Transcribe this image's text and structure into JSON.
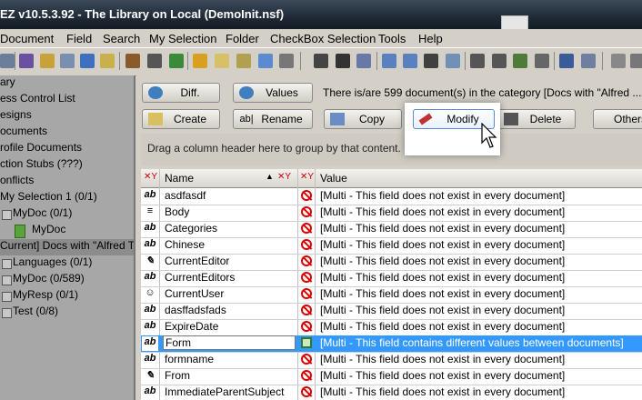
{
  "window": {
    "title": "EZ v10.5.3.92 - The Library on Local (DemoInit.nsf)"
  },
  "menu": [
    "Document",
    "Field",
    "Search",
    "My Selection",
    "Folder",
    "CheckBox Selection",
    "Tools",
    "Help"
  ],
  "left": {
    "items": [
      {
        "label": "ary"
      },
      {
        "label": "ess Control List"
      },
      {
        "label": "esigns"
      },
      {
        "label": "ocuments"
      },
      {
        "label": "rofile Documents"
      },
      {
        "label": "ction Stubs (???)"
      },
      {
        "label": "onflicts"
      },
      {
        "label": "My Selection 1  (0/1)"
      },
      {
        "label": "MyDoc  (0/1)"
      },
      {
        "label": "MyDoc"
      },
      {
        "label": "Current] Docs with \"Alfred T"
      },
      {
        "label": "Languages  (0/1)"
      },
      {
        "label": "MyDoc  (0/589)"
      },
      {
        "label": "MyResp  (0/1)"
      },
      {
        "label": "Test  (0/8)"
      }
    ]
  },
  "buttons": {
    "diff": "Diff.",
    "values": "Values",
    "create": "Create",
    "rename": "Rename",
    "copy": "Copy",
    "modify": "Modify",
    "delete": "Delete",
    "others": "Others"
  },
  "info_text": "There is/are 599 document(s) in the category [Docs with \"Alfred ...",
  "group_hint": "Drag a column header here to group by that content.",
  "grid": {
    "headers": {
      "name": "Name",
      "value": "Value"
    },
    "rows": [
      {
        "type": "ab",
        "name": "asdfasdf",
        "value": "[Multi - This field does not exist in every document]"
      },
      {
        "type": "≡",
        "name": "Body",
        "value": "[Multi - This field does not exist in every document]"
      },
      {
        "type": "ab",
        "name": "Categories",
        "value": "[Multi - This field does not exist in every document]"
      },
      {
        "type": "ab",
        "name": "Chinese",
        "value": "[Multi - This field does not exist in every document]"
      },
      {
        "type": "✎",
        "name": "CurrentEditor",
        "value": "[Multi - This field does not exist in every document]"
      },
      {
        "type": "ab",
        "name": "CurrentEditors",
        "value": "[Multi - This field does not exist in every document]"
      },
      {
        "type": "☺",
        "name": "CurrentUser",
        "value": "[Multi - This field does not exist in every document]"
      },
      {
        "type": "ab",
        "name": "dasffadsfads",
        "value": "[Multi - This field does not exist in every document]"
      },
      {
        "type": "ab",
        "name": "ExpireDate",
        "value": "[Multi - This field does not exist in every document]"
      },
      {
        "type": "ab",
        "name": "Form",
        "value": "[Multi - This field contains different values between documents]",
        "selected": true
      },
      {
        "type": "ab",
        "name": "formname",
        "value": "[Multi - This field does not exist in every document]"
      },
      {
        "type": "✎",
        "name": "From",
        "value": "[Multi - This field does not exist in every document]"
      },
      {
        "type": "ab",
        "name": "ImmediateParentSubject",
        "value": "[Multi - This field does not exist in every document]"
      }
    ]
  }
}
